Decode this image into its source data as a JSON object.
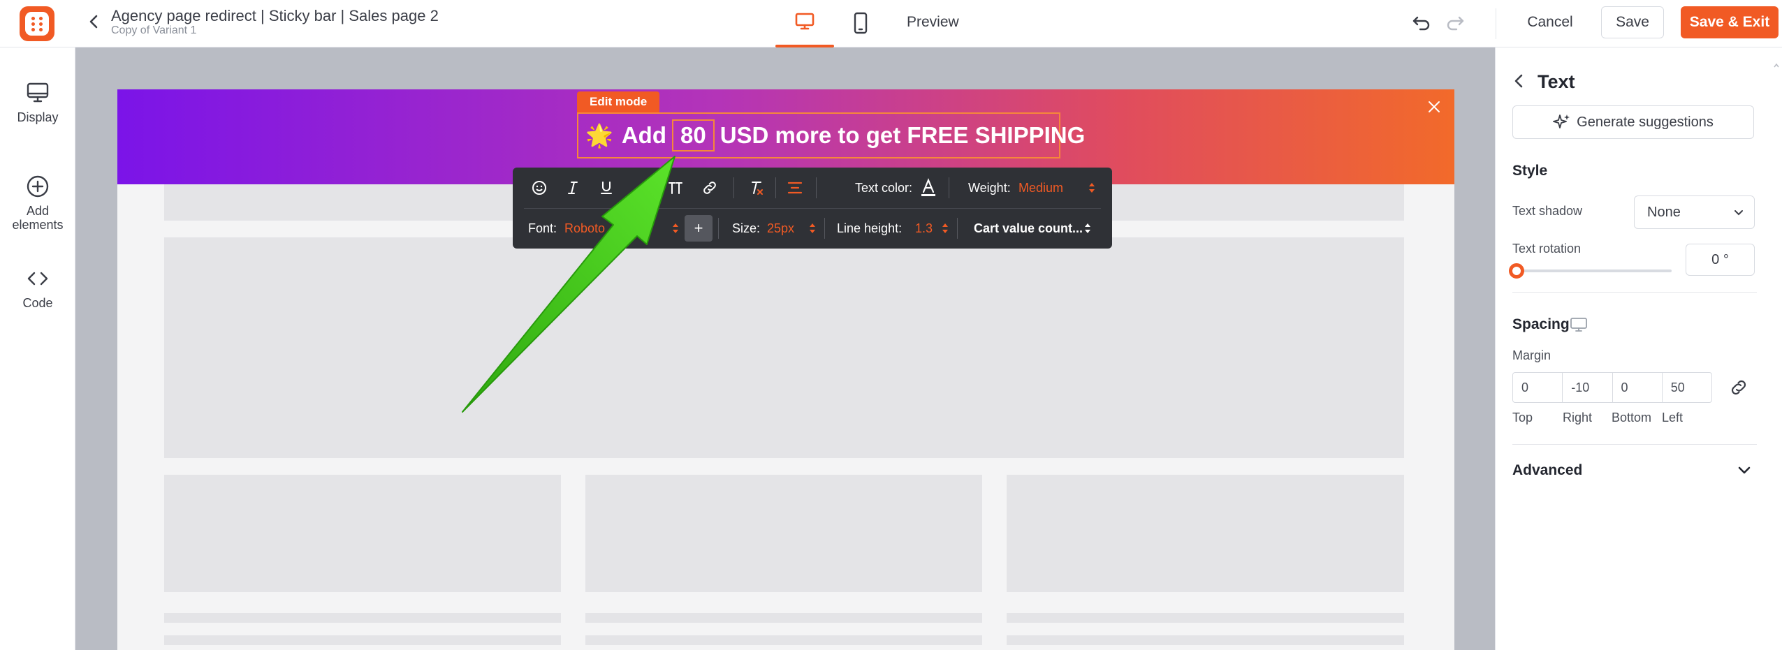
{
  "header": {
    "title": "Agency page redirect | Sticky bar | Sales page 2",
    "subtitle": "Copy of Variant 1",
    "preview_label": "Preview",
    "cancel_label": "Cancel",
    "save_label": "Save",
    "save_exit_label": "Save & Exit",
    "active_device": "desktop"
  },
  "sidebar": {
    "items": [
      {
        "label": "Display",
        "icon": "monitor-icon"
      },
      {
        "label": "Add elements",
        "icon": "plus-circle-icon"
      },
      {
        "label": "Code",
        "icon": "code-icon"
      }
    ]
  },
  "canvas": {
    "edit_mode_label": "Edit mode",
    "bar": {
      "prefix": "Add",
      "amount": "80",
      "suffix": "USD more to get FREE SHIPPING",
      "emoji": "🌟"
    }
  },
  "toolbar": {
    "text_color_label": "Text color:",
    "weight_label": "Weight:",
    "weight_value": "Medium",
    "font_label": "Font:",
    "font_value": "Roboto",
    "size_label": "Size:",
    "size_value": "25px",
    "line_height_label": "Line height:",
    "line_height_value": "1.3",
    "variable_label": "Cart value count..."
  },
  "panel": {
    "title": "Text",
    "generate_label": "Generate suggestions",
    "style_heading": "Style",
    "text_shadow_label": "Text shadow",
    "text_shadow_value": "None",
    "text_rotation_label": "Text rotation",
    "text_rotation_value": "0 °",
    "text_rotation_fraction": 0,
    "spacing_heading": "Spacing",
    "margin_label": "Margin",
    "margin": {
      "top": "0",
      "right": "-10",
      "bottom": "0",
      "left": "50",
      "top_label": "Top",
      "right_label": "Right",
      "bottom_label": "Bottom",
      "left_label": "Left"
    },
    "advanced_label": "Advanced"
  },
  "colors": {
    "accent": "#f15a24",
    "bar_gradient_start": "#7b14e8",
    "bar_gradient_end": "#f26a2a",
    "annotation_arrow": "#3fcf1c"
  }
}
